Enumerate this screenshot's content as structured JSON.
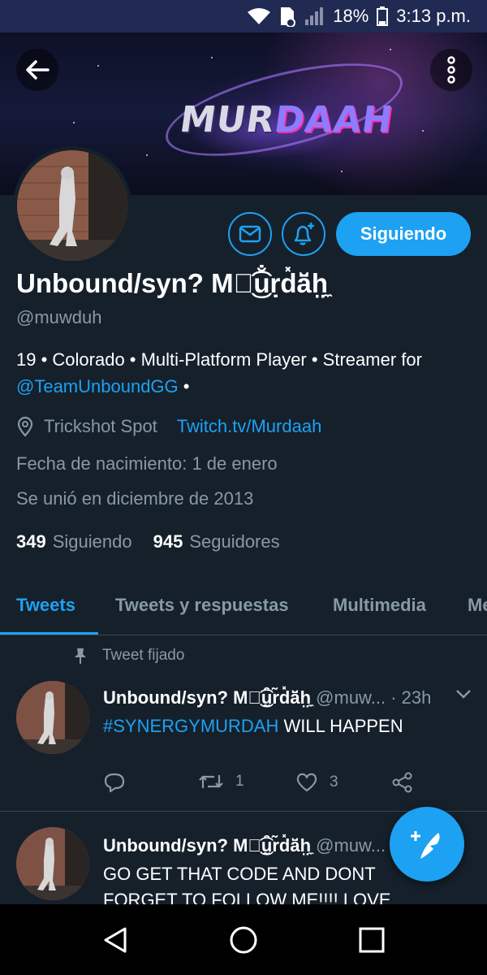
{
  "status_bar": {
    "battery": "18%",
    "time": "3:13 p.m."
  },
  "banner": {
    "logo_part1": "MUR",
    "logo_part2": "DAAH"
  },
  "profile": {
    "name": "Unbound/syn? Mཽ͜͡u̐ṛd̽ä̆h̤̼",
    "handle": "@muwduh",
    "bio_text": "19 • Colorado • Multi-Platform Player • Streamer for ",
    "bio_mention": "@TeamUnboundGG",
    "bio_suffix": " •",
    "location": "Trickshot Spot",
    "website": "Twitch.tv/Murdaah",
    "birthday": "Fecha de nacimiento: 1 de enero",
    "joined": "Se unió en diciembre de 2013",
    "following_count": "349",
    "following_label": "Siguiendo",
    "followers_count": "945",
    "followers_label": "Seguidores",
    "follow_button": "Siguiendo"
  },
  "tabs": [
    {
      "label": "Tweets",
      "active": true
    },
    {
      "label": "Tweets y respuestas",
      "active": false
    },
    {
      "label": "Multimedia",
      "active": false
    },
    {
      "label": "Me",
      "active": false
    }
  ],
  "tweets": [
    {
      "pinned_label": "Tweet fijado",
      "author": "Unbound/syn? Mཽ͜͡ṵ̑r̃d̽ä̆h̤̼",
      "handle": "@muw...",
      "time": "· 23h",
      "hashtag": "#SYNERGYMURDAH",
      "text": " WILL HAPPEN",
      "retweets": "1",
      "likes": "3"
    },
    {
      "author": "Unbound/syn? Mཽ͜͡ṵ̑r̃d̽ä̆h̤̼",
      "handle": "@muw...",
      "text_line1": "GO GET THAT CODE AND DONT",
      "text_line2": "FORGET TO FOLLOW ME!!!! LOVE"
    }
  ],
  "colors": {
    "accent": "#1da1f2",
    "background": "#15202b",
    "muted": "#8899a6",
    "border": "#38444d"
  }
}
